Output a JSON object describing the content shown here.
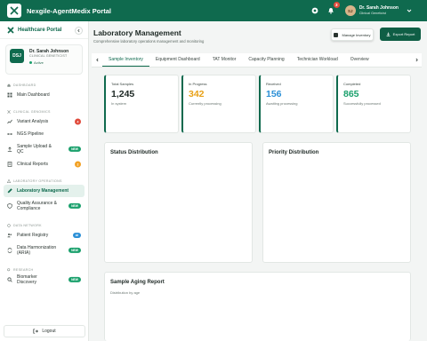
{
  "app": {
    "title": "Nexgile-AgentMedix Portal"
  },
  "topbar": {
    "notification_count": "3",
    "user": {
      "initials": "SJ",
      "name": "Dr. Sarah Johnson",
      "role": "Clinical Geneticist"
    }
  },
  "sidebar": {
    "title": "Healthcare Portal",
    "profile": {
      "initials": "DSJ",
      "name": "Dr. Sarah Johnson",
      "role": "CLINICAL GENETICIST",
      "status": "Active"
    },
    "sections": [
      {
        "label": "DASHBOARD",
        "items": [
          {
            "label": "Main Dashboard"
          }
        ]
      },
      {
        "label": "CLINICAL GENOMICS",
        "items": [
          {
            "label": "Variant Analysis",
            "badge": "4"
          },
          {
            "label": "NGS Pipeline"
          },
          {
            "label": "Sample Upload & QC",
            "badge": "NEW"
          },
          {
            "label": "Clinical Reports",
            "badge": "2"
          }
        ]
      },
      {
        "label": "LABORATORY OPERATIONS",
        "items": [
          {
            "label": "Laboratory Management"
          },
          {
            "label": "Quality Assurance & Compliance",
            "badge": "NEW"
          }
        ]
      },
      {
        "label": "DATA NETWORK",
        "items": [
          {
            "label": "Patient Registry",
            "badge": "AI"
          },
          {
            "label": "Data Harmonization (ARIA)",
            "badge": "NEW"
          }
        ]
      },
      {
        "label": "RESEARCH",
        "items": [
          {
            "label": "Biomarker Discovery",
            "badge": "NEW"
          }
        ]
      }
    ],
    "logout": "Logout"
  },
  "page": {
    "title": "Laboratory Management",
    "subtitle": "Comprehensive laboratory operations management and monitoring",
    "btn_inventory": "Manage Inventory",
    "btn_export": "Export Report"
  },
  "tabs": [
    "Sample Inventory",
    "Equipment Dashboard",
    "TAT Monitor",
    "Capacity Planning",
    "Technician Workload",
    "Overview"
  ],
  "stats": [
    {
      "label": "Total Samples",
      "value": "1,245",
      "desc": "In system",
      "color": "#1d2824"
    },
    {
      "label": "In Progress",
      "value": "342",
      "desc": "Currently processing",
      "color": "#e8a117"
    },
    {
      "label": "Received",
      "value": "156",
      "desc": "Awaiting processing",
      "color": "#2b8fd6"
    },
    {
      "label": "Completed",
      "value": "865",
      "desc": "Successfully processed",
      "color": "#1aa06c"
    }
  ],
  "panels": {
    "status": "Status Distribution",
    "priority": "Priority Distribution",
    "aging": "Sample Aging Report",
    "aging_sub": "Distribution by age"
  }
}
